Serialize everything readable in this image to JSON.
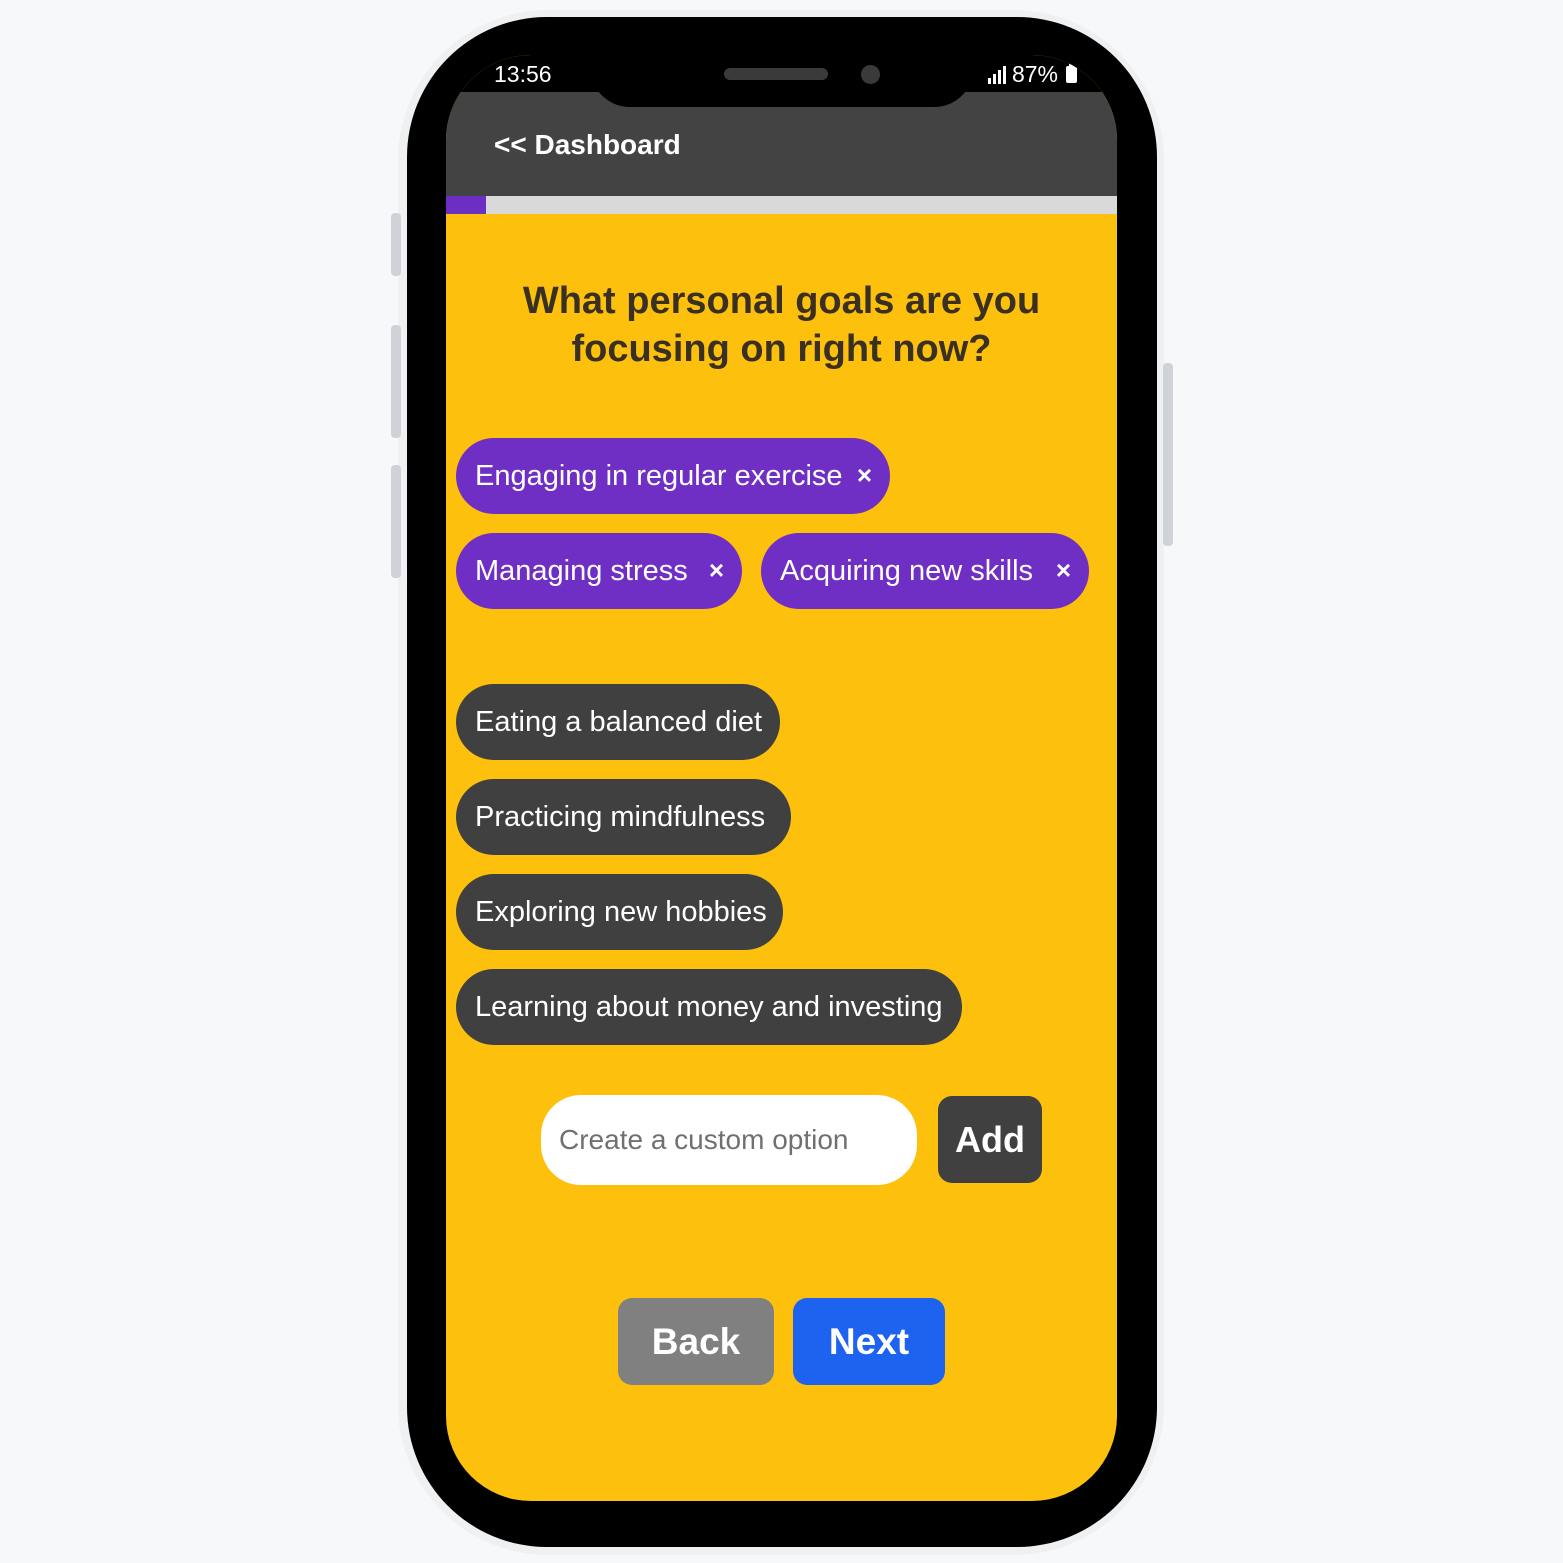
{
  "status_bar": {
    "time": "13:56",
    "battery": "87%"
  },
  "header": {
    "back_link": "<< Dashboard"
  },
  "progress": {
    "value": 0.06,
    "color": "#6b2fc4"
  },
  "question": "What personal goals are you focusing on right now?",
  "selected_goals": [
    {
      "label": "Engaging in regular exercise",
      "remove_icon": "×"
    },
    {
      "label": "Managing stress",
      "remove_icon": "×"
    },
    {
      "label": "Acquiring new skills",
      "remove_icon": "×"
    }
  ],
  "available_goals": [
    {
      "label": "Eating a balanced diet"
    },
    {
      "label": "Practicing mindfulness"
    },
    {
      "label": "Exploring new hobbies"
    },
    {
      "label": "Learning about money and investing"
    }
  ],
  "custom": {
    "placeholder": "Create a custom option",
    "add_label": "Add"
  },
  "nav": {
    "back_label": "Back",
    "next_label": "Next"
  },
  "colors": {
    "background": "#fdc00d",
    "selected_chip": "#6f2fc5",
    "unselected_chip": "#404040",
    "next_button": "#1e63f0",
    "back_button": "#808080",
    "app_bar": "#434343"
  }
}
